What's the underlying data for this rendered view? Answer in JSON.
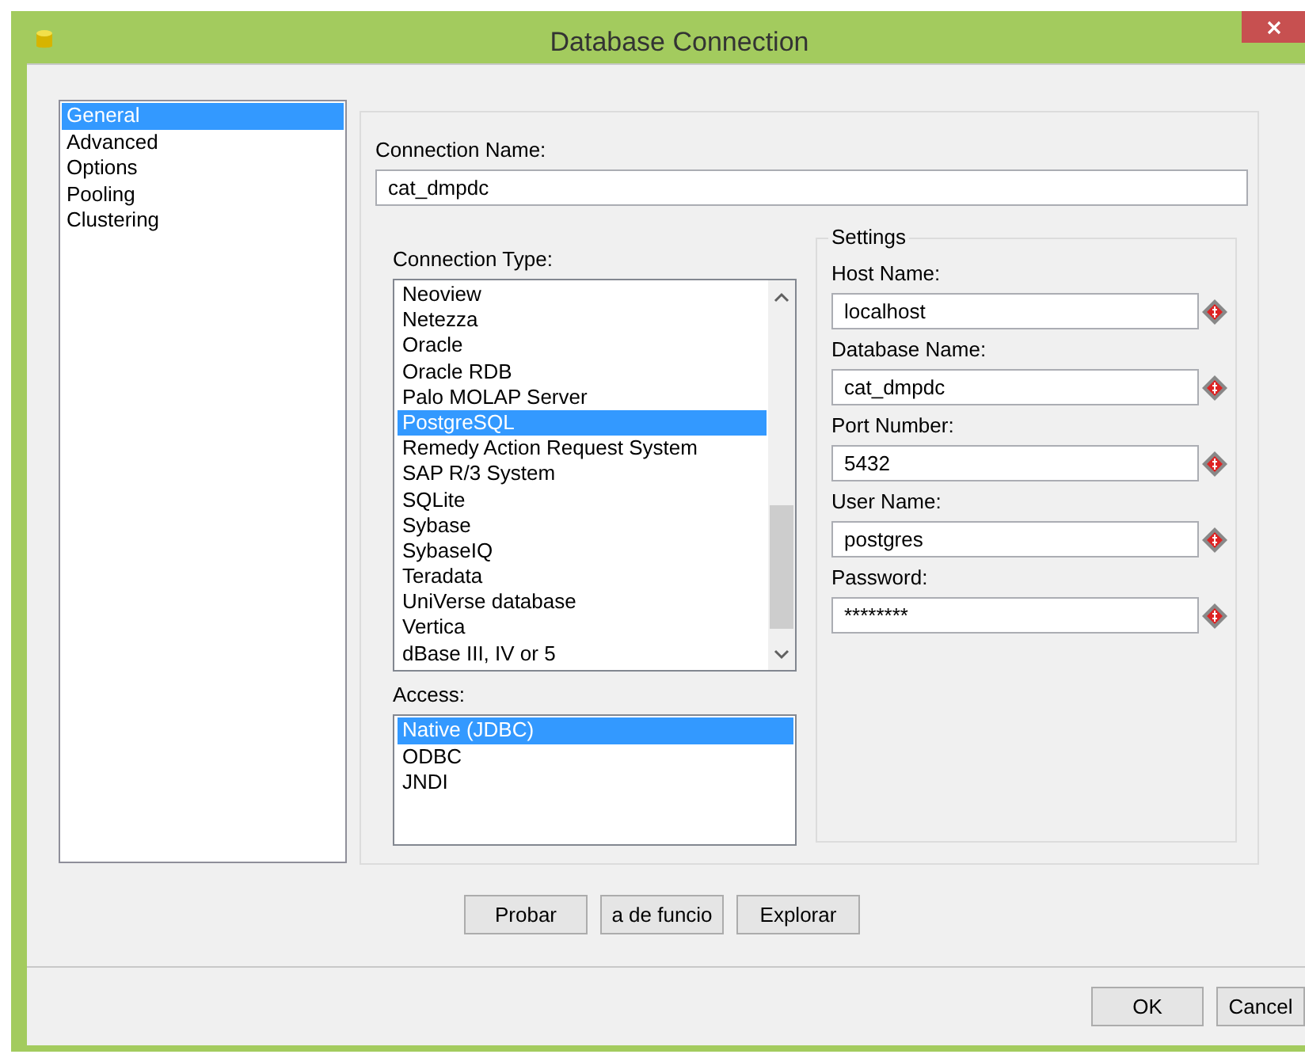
{
  "window": {
    "title": "Database Connection"
  },
  "sidebar": {
    "items": [
      {
        "label": "General",
        "selected": true
      },
      {
        "label": "Advanced",
        "selected": false
      },
      {
        "label": "Options",
        "selected": false
      },
      {
        "label": "Pooling",
        "selected": false
      },
      {
        "label": "Clustering",
        "selected": false
      }
    ]
  },
  "connection_name": {
    "label": "Connection Name:",
    "value": "cat_dmpdc"
  },
  "connection_type": {
    "label": "Connection Type:",
    "items": [
      {
        "label": "Neoview",
        "selected": false
      },
      {
        "label": "Netezza",
        "selected": false
      },
      {
        "label": "Oracle",
        "selected": false
      },
      {
        "label": "Oracle RDB",
        "selected": false
      },
      {
        "label": "Palo MOLAP Server",
        "selected": false
      },
      {
        "label": "PostgreSQL",
        "selected": true
      },
      {
        "label": "Remedy Action Request System",
        "selected": false
      },
      {
        "label": "SAP R/3 System",
        "selected": false
      },
      {
        "label": "SQLite",
        "selected": false
      },
      {
        "label": "Sybase",
        "selected": false
      },
      {
        "label": "SybaseIQ",
        "selected": false
      },
      {
        "label": "Teradata",
        "selected": false
      },
      {
        "label": "UniVerse database",
        "selected": false
      },
      {
        "label": "Vertica",
        "selected": false
      },
      {
        "label": "dBase III, IV or 5",
        "selected": false
      }
    ]
  },
  "access": {
    "label": "Access:",
    "items": [
      {
        "label": "Native (JDBC)",
        "selected": true
      },
      {
        "label": "ODBC",
        "selected": false
      },
      {
        "label": "JNDI",
        "selected": false
      }
    ]
  },
  "settings": {
    "title": "Settings",
    "fields": [
      {
        "label": "Host Name:",
        "value": "localhost"
      },
      {
        "label": "Database Name:",
        "value": "cat_dmpdc"
      },
      {
        "label": "Port Number:",
        "value": "5432"
      },
      {
        "label": "User Name:",
        "value": "postgres"
      },
      {
        "label": "Password:",
        "value": "********"
      }
    ]
  },
  "actions": [
    "Probar",
    "a de funcio",
    "Explorar"
  ],
  "footer_buttons": [
    "OK",
    "Cancel"
  ]
}
